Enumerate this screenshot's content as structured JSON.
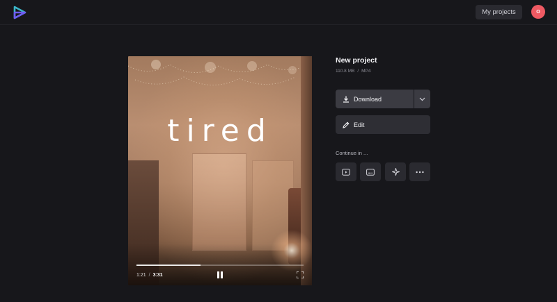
{
  "header": {
    "my_projects_label": "My projects",
    "avatar_initial": "O",
    "logo_colors": {
      "accent_teal": "#3bb7c9",
      "accent_purple": "#6f5cf1"
    }
  },
  "video": {
    "caption": "tired",
    "current_time": "1:21",
    "time_separator": "/",
    "total_time": "3:31",
    "progress_fraction": 0.383
  },
  "project": {
    "title": "New project",
    "size": "110.8 MB",
    "meta_separator": "/",
    "format": "MP4"
  },
  "actions": {
    "download_label": "Download",
    "edit_label": "Edit",
    "continue_label": "Continue in ...",
    "continue_icons": [
      "youtube-play-icon",
      "caption-icon",
      "sparkle-icon",
      "more-icon"
    ]
  },
  "colors": {
    "background": "#17171b",
    "button_primary": "#3b3b42",
    "button_secondary": "#2e2e34",
    "avatar": "#ef5a63"
  }
}
